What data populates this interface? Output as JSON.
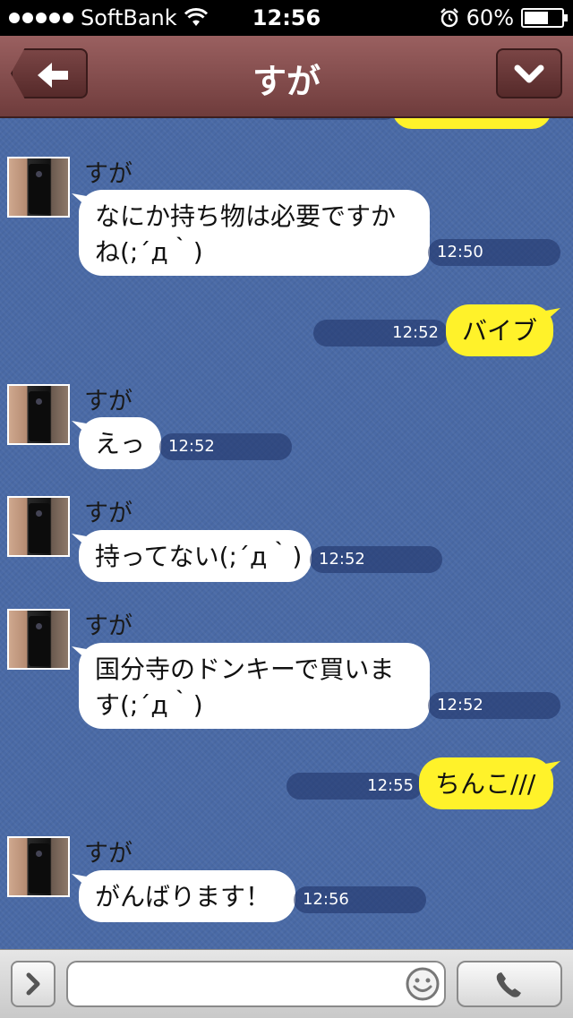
{
  "status_bar": {
    "carrier": "SoftBank",
    "time": "12:56",
    "battery": "60%",
    "battery_level": 0.6,
    "icons": [
      "signal-dots-icon",
      "wifi-icon",
      "alarm-icon",
      "battery-icon"
    ]
  },
  "header": {
    "title": "すが",
    "back_icon": "back-arrow-icon",
    "menu_icon": "chevron-down-icon"
  },
  "messages": [
    {
      "direction": "in",
      "sender": "すが",
      "lines": [
        "なにか持ち物は必要ですか",
        "ね(;´д｀)"
      ],
      "time": "12:50"
    },
    {
      "direction": "out",
      "lines": [
        "バイブ"
      ],
      "time": "12:52"
    },
    {
      "direction": "in",
      "sender": "すが",
      "lines": [
        "えっ"
      ],
      "time": "12:52"
    },
    {
      "direction": "in",
      "sender": "すが",
      "lines": [
        "持ってない(;´д｀)"
      ],
      "time": "12:52"
    },
    {
      "direction": "in",
      "sender": "すが",
      "lines": [
        "国分寺のドンキーで買いま",
        "す(;´д｀)"
      ],
      "time": "12:52"
    },
    {
      "direction": "out",
      "lines": [
        "ちんこ///"
      ],
      "time": "12:55"
    },
    {
      "direction": "in",
      "sender": "すが",
      "lines": [
        "がんばります！"
      ],
      "time": "12:56"
    }
  ],
  "input_bar": {
    "value": "",
    "expand_icon": "chevron-right-icon",
    "emoji_icon": "smiley-icon",
    "call_icon": "phone-icon"
  },
  "colors": {
    "chat_background": "#4a6aa6",
    "header": "#834e4e",
    "incoming_bubble": "#ffffff",
    "outgoing_bubble": "#fff22a"
  }
}
